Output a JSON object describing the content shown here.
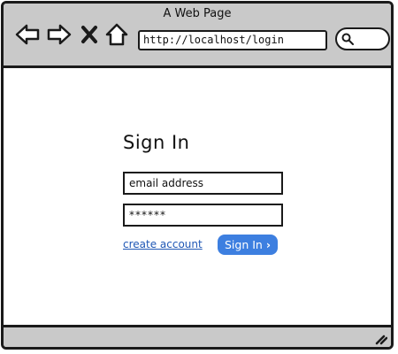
{
  "window": {
    "title": "A Web Page"
  },
  "toolbar": {
    "back_icon": "arrow-left-icon",
    "forward_icon": "arrow-right-icon",
    "stop_icon": "close-icon",
    "home_icon": "home-icon",
    "url": "http://localhost/login",
    "search_icon": "search-icon"
  },
  "login": {
    "title": "Sign In",
    "email_value": "email address",
    "password_value": "******",
    "create_account": "create account",
    "sign_in_button": "Sign In",
    "sign_in_chevron": "›"
  },
  "colors": {
    "chrome": "#c9c9c9",
    "accent": "#3d7fe0",
    "link": "#1f57b5"
  }
}
